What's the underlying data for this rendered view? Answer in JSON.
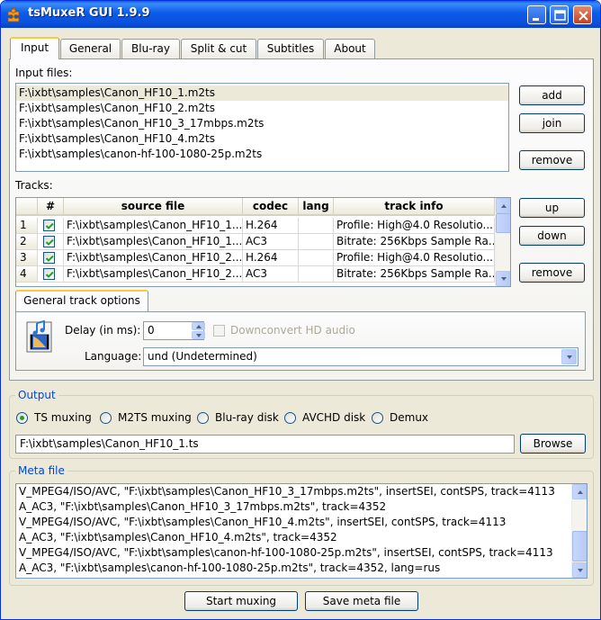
{
  "window": {
    "title": "tsMuxeR GUI 1.9.9"
  },
  "tabs": [
    {
      "label": "Input"
    },
    {
      "label": "General"
    },
    {
      "label": "Blu-ray"
    },
    {
      "label": "Split & cut"
    },
    {
      "label": "Subtitles"
    },
    {
      "label": "About"
    }
  ],
  "input": {
    "files_label": "Input files:",
    "files": [
      "F:\\ixbt\\samples\\Canon_HF10_1.m2ts",
      "F:\\ixbt\\samples\\Canon_HF10_2.m2ts",
      "F:\\ixbt\\samples\\Canon_HF10_3_17mbps.m2ts",
      "F:\\ixbt\\samples\\Canon_HF10_4.m2ts",
      "F:\\ixbt\\samples\\canon-hf-100-1080-25p.m2ts"
    ],
    "add_label": "add",
    "join_label": "join",
    "remove_label": "remove"
  },
  "tracks": {
    "label": "Tracks:",
    "headers": {
      "num": "#",
      "source": "source file",
      "codec": "codec",
      "lang": "lang",
      "info": "track info"
    },
    "rows": [
      {
        "num": "1",
        "source": "F:\\ixbt\\samples\\Canon_HF10_1...",
        "codec": "H.264",
        "lang": "",
        "info": "Profile: High@4.0  Resolutio..."
      },
      {
        "num": "2",
        "source": "F:\\ixbt\\samples\\Canon_HF10_1...",
        "codec": "AC3",
        "lang": "",
        "info": "Bitrate: 256Kbps Sample Ra..."
      },
      {
        "num": "3",
        "source": "F:\\ixbt\\samples\\Canon_HF10_2...",
        "codec": "H.264",
        "lang": "",
        "info": "Profile: High@4.0  Resolutio..."
      },
      {
        "num": "4",
        "source": "F:\\ixbt\\samples\\Canon_HF10_2...",
        "codec": "AC3",
        "lang": "",
        "info": "Bitrate: 256Kbps Sample Ra..."
      }
    ],
    "up_label": "up",
    "down_label": "down",
    "remove_label": "remove"
  },
  "track_options": {
    "tab_label": "General track options",
    "delay_label": "Delay (in ms):",
    "delay_value": "0",
    "downconvert_label": "Downconvert HD audio",
    "language_label": "Language:",
    "language_value": "und (Undetermined)"
  },
  "output": {
    "title": "Output",
    "modes": [
      "TS muxing",
      "M2TS muxing",
      "Blu-ray disk",
      "AVCHD disk",
      "Demux"
    ],
    "selected_mode": "TS muxing",
    "path": "F:\\ixbt\\samples\\Canon_HF10_1.ts",
    "browse_label": "Browse"
  },
  "meta": {
    "title": "Meta file",
    "lines": [
      "V_MPEG4/ISO/AVC, \"F:\\ixbt\\samples\\Canon_HF10_3_17mbps.m2ts\", insertSEI, contSPS, track=4113",
      "A_AC3, \"F:\\ixbt\\samples\\Canon_HF10_3_17mbps.m2ts\", track=4352",
      "V_MPEG4/ISO/AVC, \"F:\\ixbt\\samples\\Canon_HF10_4.m2ts\", insertSEI, contSPS, track=4113",
      "A_AC3, \"F:\\ixbt\\samples\\Canon_HF10_4.m2ts\", track=4352",
      "V_MPEG4/ISO/AVC, \"F:\\ixbt\\samples\\canon-hf-100-1080-25p.m2ts\", insertSEI, contSPS, track=4113",
      "A_AC3, \"F:\\ixbt\\samples\\canon-hf-100-1080-25p.m2ts\", track=4352, lang=rus"
    ]
  },
  "actions": {
    "start_label": "Start muxing",
    "save_label": "Save meta file"
  }
}
